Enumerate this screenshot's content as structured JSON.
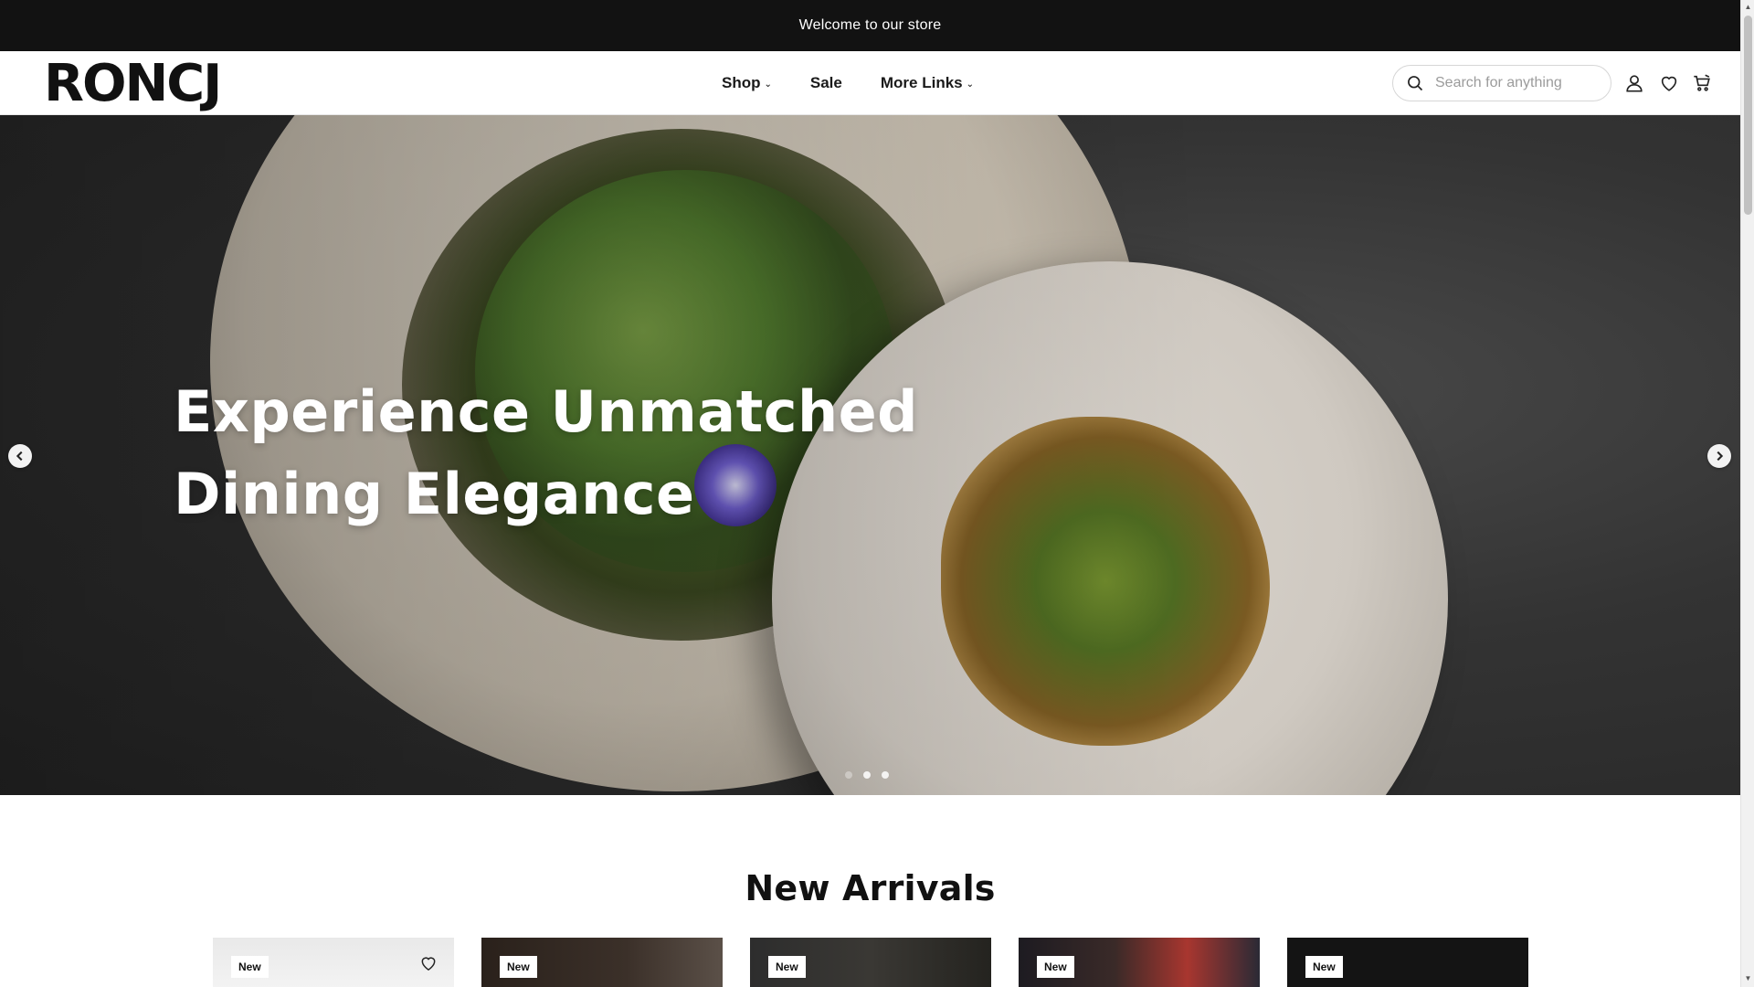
{
  "announcement": {
    "text": "Welcome to our store"
  },
  "header": {
    "logo": "RONCJ",
    "nav": [
      {
        "label": "Shop",
        "has_dropdown": true
      },
      {
        "label": "Sale",
        "has_dropdown": false
      },
      {
        "label": "More Links",
        "has_dropdown": true
      }
    ],
    "search": {
      "placeholder": "Search for anything",
      "value": "",
      "icon": "search-icon"
    },
    "icons": [
      "user-icon",
      "heart-icon",
      "cart-icon"
    ]
  },
  "hero": {
    "title_line1": "Experience Unmatched",
    "title_line2": "Dining Elegance",
    "slides": 3,
    "active_slide": 1,
    "prev_icon": "chevron-left-icon",
    "next_icon": "chevron-right-icon"
  },
  "new_arrivals": {
    "title": "New Arrivals",
    "products": [
      {
        "badge": "New",
        "wishlist": true
      },
      {
        "badge": "New",
        "wishlist": false
      },
      {
        "badge": "New",
        "wishlist": false
      },
      {
        "badge": "New",
        "wishlist": false
      },
      {
        "badge": "New",
        "wishlist": false
      }
    ]
  },
  "colors": {
    "announcement_bg": "#121212",
    "text_primary": "#111111",
    "page_bg": "#ffffff"
  }
}
